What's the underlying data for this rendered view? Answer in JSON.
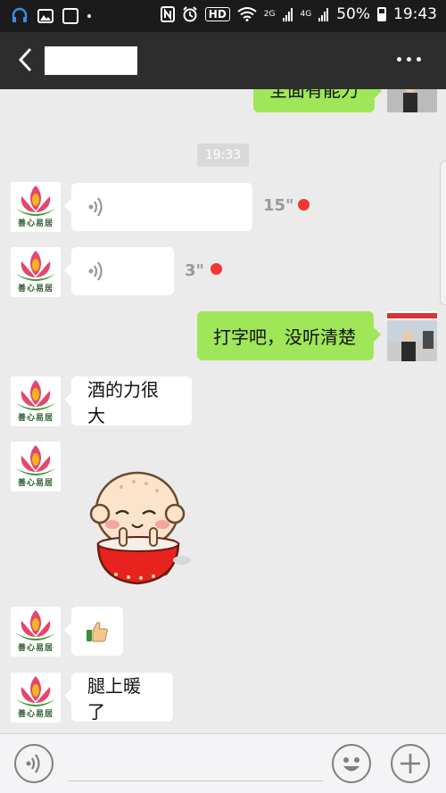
{
  "status_bar": {
    "hd_label": "HD",
    "network_1": "2G",
    "network_2": "4G",
    "battery": "50%",
    "time": "19:43"
  },
  "header": {
    "back_icon": "chevron-left-icon",
    "more_icon": "more-dots-icon"
  },
  "chat": {
    "partial_message": "全面有能力",
    "timestamp": "19:33",
    "contact_logo_text": "善心易居",
    "messages": [
      {
        "side": "left",
        "type": "voice",
        "duration": "15\"",
        "unread": true
      },
      {
        "side": "left",
        "type": "voice",
        "duration": "3\"",
        "unread": true
      },
      {
        "side": "right",
        "type": "text",
        "text": "打字吧，没听清楚"
      },
      {
        "side": "left",
        "type": "text",
        "text": "酒的力很大"
      },
      {
        "side": "left",
        "type": "sticker",
        "sticker": "monk-bowl-sticker"
      },
      {
        "side": "left",
        "type": "emoji",
        "emoji": "👍"
      },
      {
        "side": "left",
        "type": "text",
        "text": "腿上暖了"
      }
    ]
  },
  "input_bar": {
    "voice_icon": "voice-toggle-icon",
    "emoji_icon": "emoji-icon",
    "plus_icon": "plus-icon"
  },
  "colors": {
    "header_bg": "#2d2d2d",
    "chat_bg": "#ebebeb",
    "sent_bubble": "#9fe658",
    "unread_dot": "#f43530"
  }
}
